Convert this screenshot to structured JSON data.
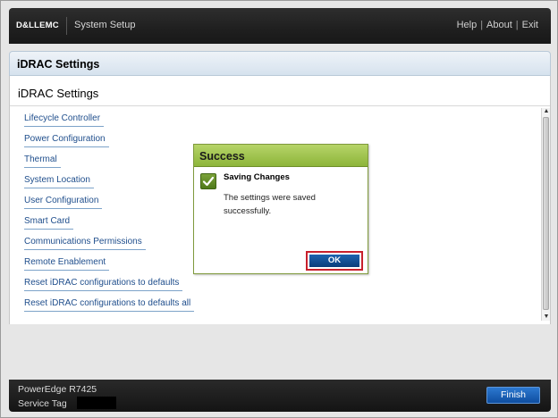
{
  "header": {
    "logo_text": "D&LLEMC",
    "app_title": "System Setup",
    "links": [
      "Help",
      "About",
      "Exit"
    ],
    "separator": "|"
  },
  "title_bar": {
    "title": "iDRAC Settings"
  },
  "panel": {
    "subtitle": "iDRAC Settings",
    "menu_items": [
      "Lifecycle Controller",
      "Power Configuration",
      "Thermal",
      "System Location",
      "User Configuration",
      "Smart Card",
      "Communications Permissions",
      "Remote Enablement",
      "Reset iDRAC configurations to defaults",
      "Reset iDRAC configurations to defaults all"
    ]
  },
  "dialog": {
    "title": "Success",
    "message_title": "Saving Changes",
    "message_body": "The settings were saved successfully.",
    "ok_label": "OK",
    "accent": "#8db53a",
    "highlight": "#c8202c"
  },
  "footer": {
    "model": "PowerEdge R7425",
    "service_tag_label": "Service Tag",
    "service_tag_value": "",
    "finish_label": "Finish"
  },
  "colors": {
    "link": "#1f4e8c",
    "button": "#0f4ea0",
    "header_bg": "#1f1f1f"
  }
}
